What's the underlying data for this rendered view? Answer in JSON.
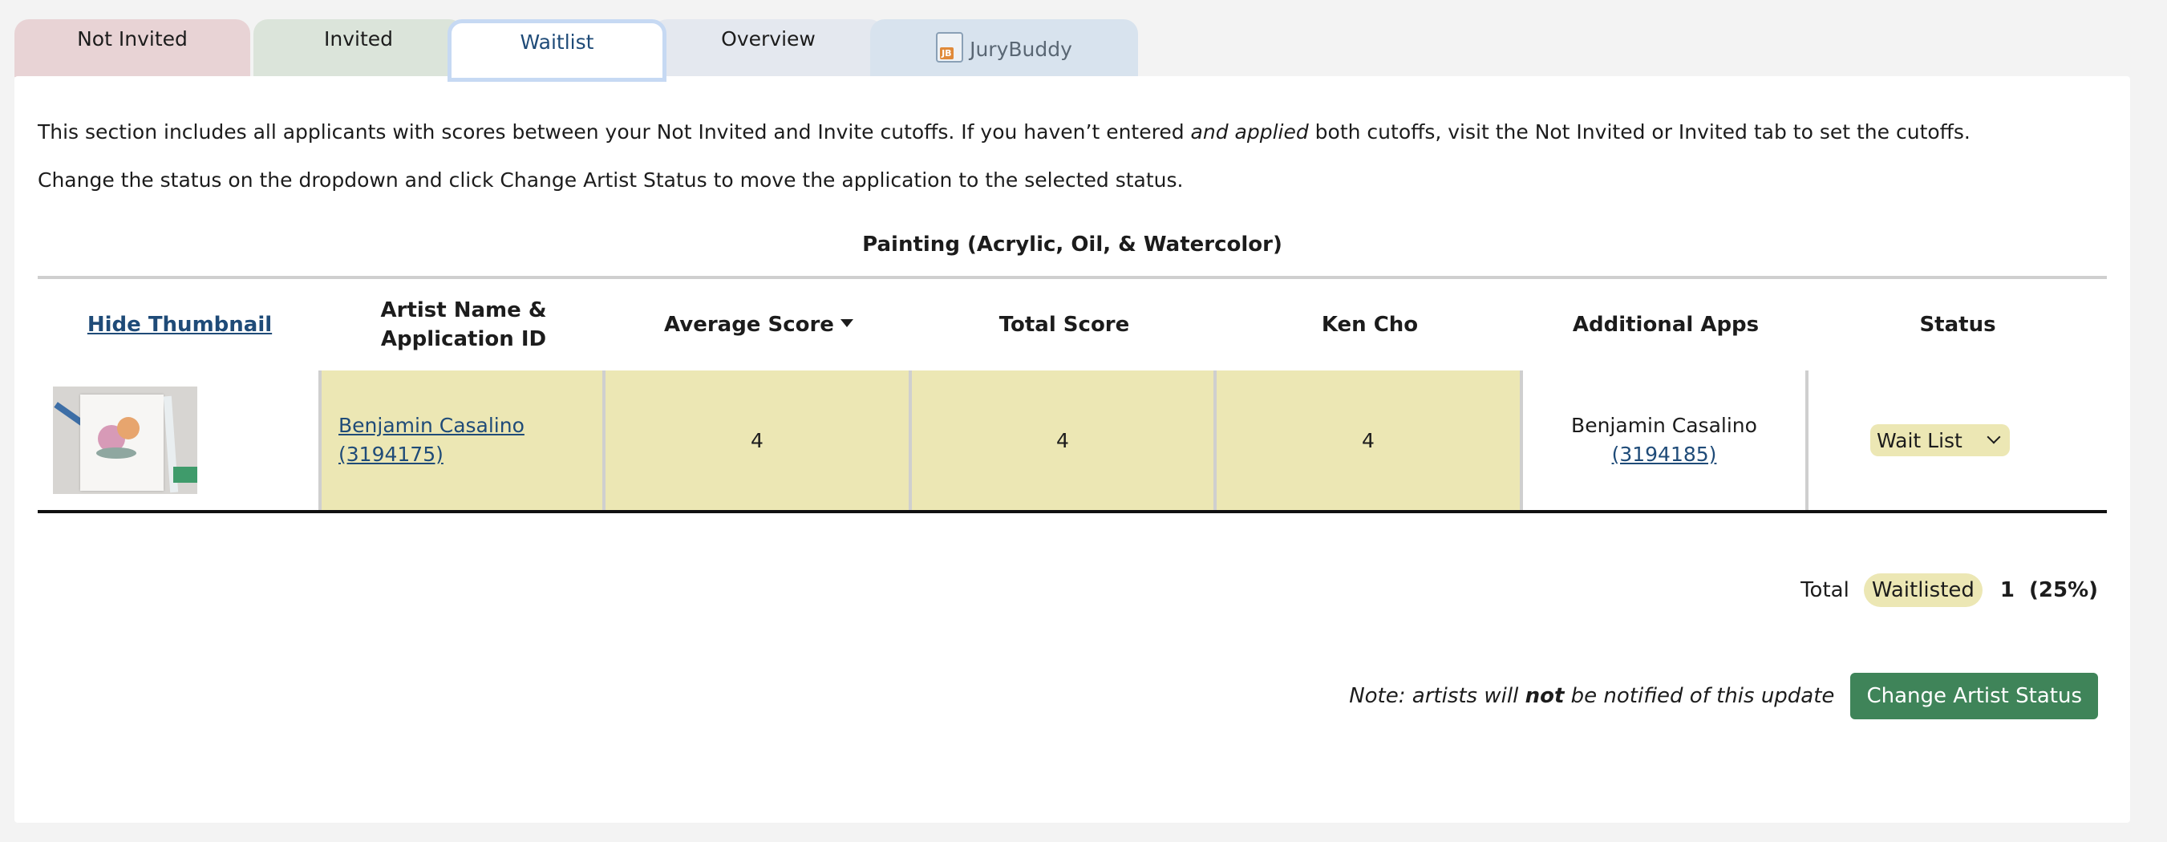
{
  "tabs": {
    "not_invited": "Not Invited",
    "invited": "Invited",
    "waitlist": "Waitlist",
    "overview": "Overview",
    "jurybuddy": "JuryBuddy"
  },
  "intro": {
    "line1_a": "This section includes all applicants with scores between your Not Invited and Invite cutoffs. If you haven’t entered ",
    "line1_em": "and applied",
    "line1_b": " both cutoffs, visit the Not Invited or Invited tab to set the cutoffs.",
    "line2": "Change the status on the dropdown and click Change Artist Status to move the application to the selected status."
  },
  "table": {
    "title": "Painting (Acrylic, Oil, & Watercolor)",
    "headers": {
      "thumbnail": "Hide Thumbnail",
      "name_line1": "Artist Name &",
      "name_line2": "Application ID",
      "average": "Average Score",
      "total": "Total Score",
      "juror": "Ken Cho",
      "additional": "Additional Apps",
      "status": "Status"
    },
    "rows": [
      {
        "artist_name": "Benjamin Casalino",
        "app_id": "(3194175)",
        "average": "4",
        "total": "4",
        "juror_score": "4",
        "additional_name": "Benjamin Casalino",
        "additional_id": "(3194185)",
        "status": "Wait List"
      }
    ]
  },
  "totals": {
    "label": "Total",
    "status": "Waitlisted",
    "count": "1",
    "percent": "(25%)"
  },
  "action": {
    "note_prefix": "Note: artists will ",
    "note_bold": "not",
    "note_suffix": " be notified of this update",
    "button": "Change Artist Status"
  },
  "colors": {
    "highlight": "#ece7b4",
    "accent_button": "#3f8459",
    "link": "#1f4b78"
  }
}
